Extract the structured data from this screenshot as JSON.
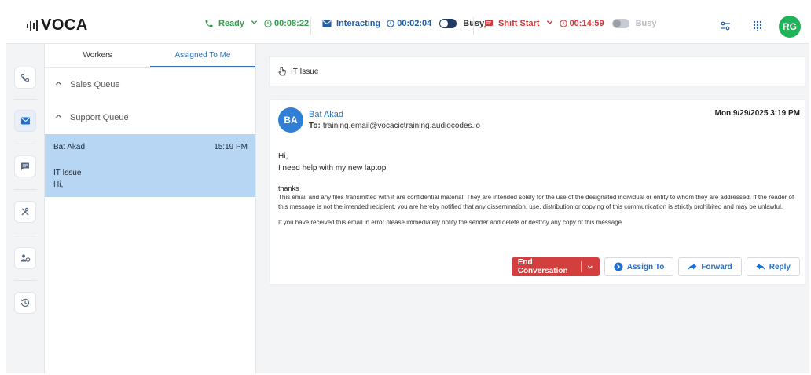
{
  "app": {
    "logo": "VOCA"
  },
  "topbar": {
    "ready_label": "Ready",
    "ready_timer": "00:08:22",
    "interacting_label": "Interacting",
    "interacting_timer": "00:02:04",
    "busy_label_1": "Busy",
    "shift_label": "Shift Start",
    "shift_timer": "00:14:59",
    "busy_label_2": "Busy",
    "user_initials": "RG"
  },
  "colors": {
    "ready": "#2e9e46",
    "interacting": "#1f5fa8",
    "shift": "#d23a3a",
    "accent": "#2d6fb8",
    "end_button": "#d33f3f",
    "selected_item": "#b7d6f4"
  },
  "left_rail": {
    "items": [
      "phone-icon",
      "email-icon",
      "chat-icon",
      "tools-icon",
      "team-icon",
      "history-icon"
    ],
    "active": "email-icon"
  },
  "queue_panel": {
    "tabs": [
      {
        "label": "Workers"
      },
      {
        "label": "Assigned To Me"
      }
    ],
    "active_tab": "Assigned To Me",
    "queues": [
      {
        "label": "Sales Queue"
      },
      {
        "label": "Support Queue"
      }
    ],
    "conversation": {
      "name": "Bat Akad",
      "time": "15:19 PM",
      "subject": "IT Issue",
      "preview": "Hi,"
    }
  },
  "main": {
    "subject": "IT Issue",
    "email": {
      "avatar": "BA",
      "sender": "Bat Akad",
      "to_label": "To:",
      "to": "training.email@vocacictraining.audiocodes.io",
      "date": "Mon 9/29/2025 3:19 PM",
      "body_greeting": "Hi,",
      "body_line": "I need help with my new laptop",
      "body_thanks": "thanks",
      "disclaimer": "This email and any files transmitted with it are confidential material. They are intended solely for the use of the designated individual or entity to whom they are addressed. If the reader of this message is not the intended recipient, you are hereby notified that any dissemination, use, distribution or copying of this communication is strictly prohibited and may be unlawful.",
      "error_notice": "If you have received this email in error please immediately notify the sender and delete or destroy any copy of this message"
    },
    "actions": {
      "end": "End Conversation",
      "assign": "Assign To",
      "forward": "Forward",
      "reply": "Reply"
    }
  }
}
